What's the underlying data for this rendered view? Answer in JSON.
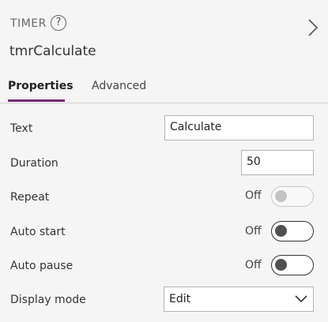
{
  "header": {
    "control_type": "TIMER",
    "help_glyph": "?",
    "control_name": "tmrCalculate"
  },
  "tabs": [
    {
      "label": "Properties",
      "active": true
    },
    {
      "label": "Advanced",
      "active": false
    }
  ],
  "properties": {
    "text": {
      "label": "Text",
      "value": "Calculate"
    },
    "duration": {
      "label": "Duration",
      "value": "50"
    },
    "repeat": {
      "label": "Repeat",
      "state": "Off",
      "enabled": false
    },
    "auto_start": {
      "label": "Auto start",
      "state": "Off",
      "enabled": true
    },
    "auto_pause": {
      "label": "Auto pause",
      "state": "Off",
      "enabled": true
    },
    "display_mode": {
      "label": "Display mode",
      "value": "Edit"
    }
  },
  "icons": {
    "help": "help-circle-icon",
    "expand": "chevron-right-icon",
    "dropdown": "chevron-down-icon"
  },
  "colors": {
    "accent": "#742774",
    "background": "#f5f5f5"
  }
}
